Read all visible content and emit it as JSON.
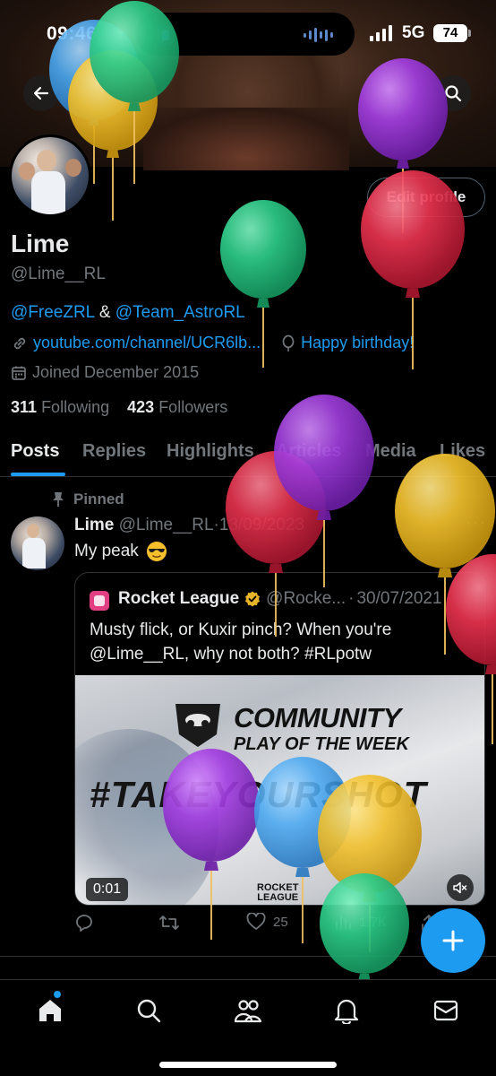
{
  "status_bar": {
    "time": "09:46",
    "network": "5G",
    "battery": "74"
  },
  "profile": {
    "display_name": "Lime",
    "handle": "@Lime__RL",
    "bio_mention_1": "@FreeZRL",
    "bio_joiner": " & ",
    "bio_mention_2": "@Team_AstroRL",
    "website": "youtube.com/channel/UCR6lb...",
    "birthday": "Happy birthday!",
    "joined": "Joined December 2015",
    "following_count": "311",
    "following_label": "Following",
    "followers_count": "423",
    "followers_label": "Followers",
    "edit_profile_label": "Edit profile"
  },
  "tabs": [
    "Posts",
    "Replies",
    "Highlights",
    "Articles",
    "Media",
    "Likes"
  ],
  "pinned_tweet": {
    "pinned_label": "Pinned",
    "author_name": "Lime",
    "author_handle": "@Lime__RL",
    "date_sep": "·",
    "date": "13/09/2023",
    "text": "My peak",
    "more": "···",
    "quote": {
      "author_name": "Rocket League",
      "author_handle": "@Rocke...",
      "date_sep": "·",
      "date": "30/07/2021",
      "text": "Musty flick, or Kuxir pinch? When you're @Lime__RL, why not both? #RLpotw",
      "media": {
        "heading": "COMMUNITY",
        "subheading": "PLAY OF THE WEEK",
        "hashtag": "#TAKEYOURSHOT",
        "brand_line1": "ROCKET",
        "brand_line2": "LEAGUE",
        "duration": "0:01"
      }
    },
    "actions": {
      "likes": "25",
      "views": "1.7K"
    }
  },
  "icons": {
    "back": "arrow-left-icon",
    "search": "search-icon",
    "link": "link-icon",
    "birthday": "balloon-icon",
    "calendar": "calendar-icon",
    "pin": "pin-icon",
    "reply": "reply-icon",
    "retweet": "retweet-icon",
    "like": "heart-icon",
    "views": "views-icon",
    "compose": "plus-icon",
    "home": "home-icon",
    "explore": "search-icon",
    "communities": "people-icon",
    "notifications": "bell-icon",
    "messages": "mail-icon",
    "mute": "muted-speaker-icon",
    "verified": "gold-verified-badge-icon"
  },
  "colors": {
    "accent": "#1d9bf0",
    "background": "#000000",
    "text": "#e7e9ea",
    "muted": "#71767b",
    "balloon_green": "#2ecc8a",
    "balloon_blue": "#4aa8f0",
    "balloon_yellow": "#f2c12e",
    "balloon_purple": "#a23ee0",
    "balloon_red": "#e8334f"
  }
}
